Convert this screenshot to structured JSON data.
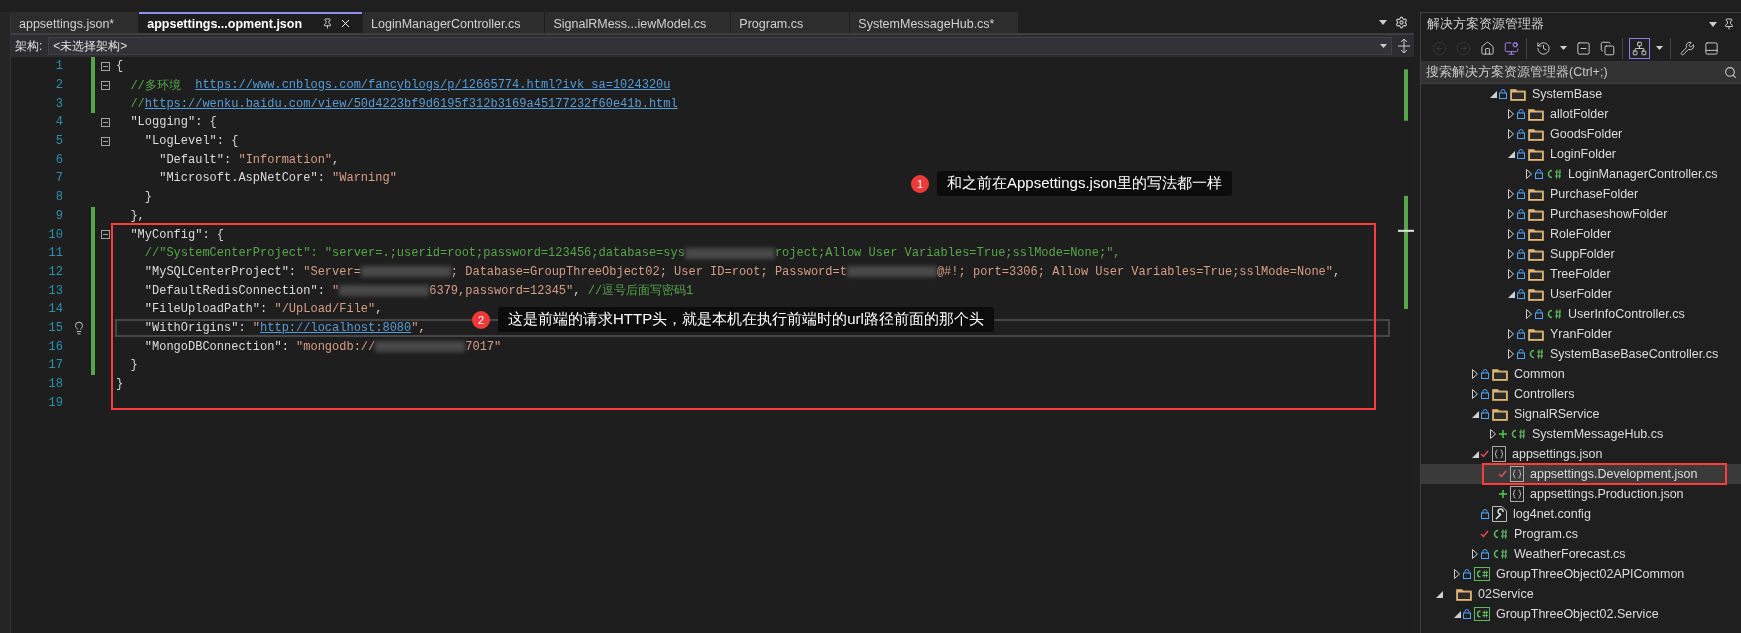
{
  "tabs": [
    {
      "label": "appsettings.json*",
      "selected": false
    },
    {
      "label": "appsettings...opment.json",
      "selected": true
    },
    {
      "label": "LoginManagerController.cs",
      "selected": false
    },
    {
      "label": "SignalRMess...iewModel.cs",
      "selected": false
    },
    {
      "label": "Program.cs",
      "selected": false
    },
    {
      "label": "SystemMessageHub.cs*",
      "selected": false
    }
  ],
  "architecture": {
    "label": "架构:",
    "value": "<未选择架构>"
  },
  "editor": {
    "highlight_box": true,
    "lines": [
      {
        "number": "1",
        "changed": true,
        "fold": true,
        "current": false,
        "tokens": [
          {
            "kind": "punct",
            "text": "{"
          }
        ]
      },
      {
        "number": "2",
        "changed": true,
        "fold": true,
        "current": false,
        "tokens": [
          {
            "kind": "comment",
            "text": "  //多环境  "
          },
          {
            "kind": "link",
            "text": "https://www.cnblogs.com/fancyblogs/p/12665774.html?ivk_sa=1024320u"
          }
        ]
      },
      {
        "number": "3",
        "changed": true,
        "fold": false,
        "current": false,
        "tokens": [
          {
            "kind": "comment",
            "text": "  //"
          },
          {
            "kind": "link",
            "text": "https://wenku.baidu.com/view/50d4223bf9d6195f312b3169a45177232f60e41b.html"
          }
        ]
      },
      {
        "number": "4",
        "changed": false,
        "fold": true,
        "current": false,
        "tokens": [
          {
            "kind": "key",
            "text": "  \"Logging\""
          },
          {
            "kind": "punct",
            "text": ": {"
          }
        ]
      },
      {
        "number": "5",
        "changed": false,
        "fold": true,
        "current": false,
        "tokens": [
          {
            "kind": "key",
            "text": "    \"LogLevel\""
          },
          {
            "kind": "punct",
            "text": ": {"
          }
        ]
      },
      {
        "number": "6",
        "changed": false,
        "fold": false,
        "current": false,
        "tokens": [
          {
            "kind": "key",
            "text": "      \"Default\""
          },
          {
            "kind": "punct",
            "text": ": "
          },
          {
            "kind": "string",
            "text": "\"Information\""
          },
          {
            "kind": "punct",
            "text": ","
          }
        ]
      },
      {
        "number": "7",
        "changed": false,
        "fold": false,
        "current": false,
        "tokens": [
          {
            "kind": "key",
            "text": "      \"Microsoft.AspNetCore\""
          },
          {
            "kind": "punct",
            "text": ": "
          },
          {
            "kind": "string",
            "text": "\"Warning\""
          }
        ]
      },
      {
        "number": "8",
        "changed": false,
        "fold": false,
        "current": false,
        "tokens": [
          {
            "kind": "punct",
            "text": "    }"
          }
        ]
      },
      {
        "number": "9",
        "changed": true,
        "fold": false,
        "current": false,
        "tokens": [
          {
            "kind": "punct",
            "text": "  },"
          }
        ]
      },
      {
        "number": "10",
        "changed": true,
        "fold": true,
        "current": false,
        "tokens": [
          {
            "kind": "key",
            "text": "  \"MyConfig\""
          },
          {
            "kind": "punct",
            "text": ": {"
          }
        ]
      },
      {
        "number": "11",
        "changed": true,
        "fold": false,
        "current": false,
        "tokens": [
          {
            "kind": "comment",
            "text": "    //\"SystemCenterProject\": \"server=.;userid=root;password=123456;database=sys"
          },
          {
            "kind": "redacted"
          },
          {
            "kind": "comment",
            "text": "roject;Allow User Variables=True;sslMode=None;\","
          }
        ]
      },
      {
        "number": "12",
        "changed": true,
        "fold": false,
        "current": false,
        "tokens": [
          {
            "kind": "key",
            "text": "    \"MySQLCenterProject\""
          },
          {
            "kind": "punct",
            "text": ": "
          },
          {
            "kind": "string",
            "text": "\"Server="
          },
          {
            "kind": "redacted"
          },
          {
            "kind": "string",
            "text": "; Database=GroupThreeObject02; User ID=root; Password=t"
          },
          {
            "kind": "redacted"
          },
          {
            "kind": "string",
            "text": "@#!; port=3306; Allow User Variables=True;sslMode=None\""
          },
          {
            "kind": "punct",
            "text": ","
          }
        ]
      },
      {
        "number": "13",
        "changed": true,
        "fold": false,
        "current": false,
        "tokens": [
          {
            "kind": "key",
            "text": "    \"DefaultRedisConnection\""
          },
          {
            "kind": "punct",
            "text": ": "
          },
          {
            "kind": "string",
            "text": "\""
          },
          {
            "kind": "redacted"
          },
          {
            "kind": "string",
            "text": "6379,password=12345\""
          },
          {
            "kind": "punct",
            "text": ", "
          },
          {
            "kind": "comment",
            "text": "//逗号后面写密码1"
          }
        ]
      },
      {
        "number": "14",
        "changed": true,
        "fold": false,
        "current": false,
        "tokens": [
          {
            "kind": "key",
            "text": "    \"FileUploadPath\""
          },
          {
            "kind": "punct",
            "text": ": "
          },
          {
            "kind": "string",
            "text": "\"/UpLoad/File\""
          },
          {
            "kind": "punct",
            "text": ","
          }
        ]
      },
      {
        "number": "15",
        "changed": true,
        "fold": false,
        "current": true,
        "tokens": [
          {
            "kind": "key",
            "text": "    \"WithOrigins\""
          },
          {
            "kind": "punct",
            "text": ": "
          },
          {
            "kind": "string",
            "text": "\""
          },
          {
            "kind": "link",
            "text": "http://localhost:8080"
          },
          {
            "kind": "string",
            "text": "\""
          },
          {
            "kind": "punct",
            "text": ","
          }
        ]
      },
      {
        "number": "16",
        "changed": true,
        "fold": false,
        "current": false,
        "tokens": [
          {
            "kind": "key",
            "text": "    \"MongoDBConnection\""
          },
          {
            "kind": "punct",
            "text": ": "
          },
          {
            "kind": "string",
            "text": "\"mongodb://"
          },
          {
            "kind": "redacted"
          },
          {
            "kind": "string",
            "text": "7017\""
          }
        ]
      },
      {
        "number": "17",
        "changed": true,
        "fold": false,
        "current": false,
        "tokens": [
          {
            "kind": "punct",
            "text": "  }"
          }
        ]
      },
      {
        "number": "18",
        "changed": false,
        "fold": false,
        "current": false,
        "tokens": [
          {
            "kind": "punct",
            "text": "}"
          }
        ]
      },
      {
        "number": "19",
        "changed": false,
        "fold": false,
        "current": false
      }
    ],
    "annotations": [
      {
        "number": "1",
        "text": "和之前在Appsettings.json里的写法都一样"
      },
      {
        "number": "2",
        "text": "这是前端的请求HTTP头，就是本机在执行前端时的url路径前面的那个头"
      }
    ]
  },
  "explorer": {
    "title": "解决方案资源管理器",
    "toolbar": [
      {
        "buttons": [
          {
            "kind": "back",
            "disabled": true,
            "pressed": false
          },
          {
            "kind": "forward",
            "disabled": true,
            "pressed": false
          },
          {
            "kind": "home",
            "disabled": false,
            "pressed": false
          },
          {
            "kind": "switch-views",
            "disabled": false,
            "pressed": false
          }
        ]
      },
      {
        "buttons": [
          {
            "kind": "history",
            "disabled": false,
            "pressed": false
          },
          {
            "kind": "dropdown",
            "disabled": false,
            "pressed": false
          },
          {
            "kind": "collapse",
            "disabled": false,
            "pressed": false
          },
          {
            "kind": "copy",
            "disabled": false,
            "pressed": false
          }
        ]
      },
      {
        "buttons": [
          {
            "kind": "tree-view",
            "disabled": false,
            "pressed": true
          },
          {
            "kind": "dropdown",
            "disabled": false,
            "pressed": false
          }
        ]
      },
      {
        "buttons": [
          {
            "kind": "properties",
            "disabled": false,
            "pressed": false
          },
          {
            "kind": "preview",
            "disabled": false,
            "pressed": false
          }
        ]
      }
    ],
    "search": {
      "placeholder": "搜索解决方案资源管理器(Ctrl+;)"
    },
    "tree": [
      {
        "children": [
          {
            "children": [
              {
                "children": [
                  {
                    "label": "SystemBase",
                    "kind": "folder",
                    "locked": true,
                    "edited": false,
                    "added": false,
                    "expanded": true,
                    "selected": false,
                    "marked": false,
                    "children": [
                      {
                        "label": "allotFolder",
                        "kind": "folder",
                        "locked": true,
                        "edited": false,
                        "added": false,
                        "expanded": false,
                        "selected": false,
                        "marked": false
                      },
                      {
                        "label": "GoodsFolder",
                        "kind": "folder",
                        "locked": true,
                        "edited": false,
                        "added": false,
                        "expanded": false,
                        "selected": false,
                        "marked": false
                      },
                      {
                        "label": "LoginFolder",
                        "kind": "folder",
                        "locked": true,
                        "edited": false,
                        "added": false,
                        "expanded": true,
                        "selected": false,
                        "marked": false,
                        "children": [
                          {
                            "label": "LoginManagerController.cs",
                            "kind": "csharp",
                            "locked": true,
                            "edited": false,
                            "added": false,
                            "expanded": false,
                            "selected": false,
                            "marked": false
                          }
                        ]
                      },
                      {
                        "label": "PurchaseFolder",
                        "kind": "folder",
                        "locked": true,
                        "edited": false,
                        "added": false,
                        "expanded": false,
                        "selected": false,
                        "marked": false
                      },
                      {
                        "label": "PurchaseshowFolder",
                        "kind": "folder",
                        "locked": true,
                        "edited": false,
                        "added": false,
                        "expanded": false,
                        "selected": false,
                        "marked": false
                      },
                      {
                        "label": "RoleFolder",
                        "kind": "folder",
                        "locked": true,
                        "edited": false,
                        "added": false,
                        "expanded": false,
                        "selected": false,
                        "marked": false
                      },
                      {
                        "label": "SuppFolder",
                        "kind": "folder",
                        "locked": true,
                        "edited": false,
                        "added": false,
                        "expanded": false,
                        "selected": false,
                        "marked": false
                      },
                      {
                        "label": "TreeFolder",
                        "kind": "folder",
                        "locked": true,
                        "edited": false,
                        "added": false,
                        "expanded": false,
                        "selected": false,
                        "marked": false
                      },
                      {
                        "label": "UserFolder",
                        "kind": "folder",
                        "locked": true,
                        "edited": false,
                        "added": false,
                        "expanded": true,
                        "selected": false,
                        "marked": false,
                        "children": [
                          {
                            "label": "UserInfoController.cs",
                            "kind": "csharp",
                            "locked": true,
                            "edited": false,
                            "added": false,
                            "expanded": false,
                            "selected": false,
                            "marked": false
                          }
                        ]
                      },
                      {
                        "label": "YranFolder",
                        "kind": "folder",
                        "locked": true,
                        "edited": false,
                        "added": false,
                        "expanded": false,
                        "selected": false,
                        "marked": false
                      },
                      {
                        "label": "SystemBaseBaseController.cs",
                        "kind": "csharp",
                        "locked": true,
                        "edited": false,
                        "added": false,
                        "expanded": false,
                        "selected": false,
                        "marked": false
                      }
                    ]
                  }
                ]
              },
              {
                "label": "Common",
                "kind": "folder",
                "locked": true,
                "edited": false,
                "added": false,
                "expanded": false,
                "selected": false,
                "marked": false
              },
              {
                "label": "Controllers",
                "kind": "folder",
                "locked": true,
                "edited": false,
                "added": false,
                "expanded": false,
                "selected": false,
                "marked": false
              },
              {
                "label": "SignalRService",
                "kind": "folder",
                "locked": true,
                "edited": false,
                "added": false,
                "expanded": true,
                "selected": false,
                "marked": false,
                "children": [
                  {
                    "label": "SystemMessageHub.cs",
                    "kind": "csharp",
                    "locked": false,
                    "edited": false,
                    "added": true,
                    "expanded": false,
                    "selected": false,
                    "marked": false
                  }
                ]
              },
              {
                "label": "appsettings.json",
                "kind": "json",
                "locked": false,
                "edited": true,
                "added": false,
                "expanded": true,
                "selected": false,
                "marked": false,
                "children": [
                  {
                    "label": "appsettings.Development.json",
                    "kind": "json",
                    "locked": false,
                    "edited": true,
                    "added": false,
                    "selected": true,
                    "marked": true
                  },
                  {
                    "label": "appsettings.Production.json",
                    "kind": "json",
                    "locked": false,
                    "edited": false,
                    "added": true,
                    "selected": false,
                    "marked": false
                  }
                ]
              },
              {
                "label": "log4net.config",
                "kind": "config",
                "locked": true,
                "edited": false,
                "added": false,
                "selected": false,
                "marked": false
              },
              {
                "label": "Program.cs",
                "kind": "csharp",
                "locked": false,
                "edited": true,
                "added": false,
                "selected": false,
                "marked": false
              },
              {
                "label": "WeatherForecast.cs",
                "kind": "csharp",
                "locked": true,
                "edited": false,
                "added": false,
                "expanded": false,
                "selected": false,
                "marked": false
              }
            ]
          },
          {
            "label": "GroupThreeObject02APICommon",
            "kind": "project",
            "locked": true,
            "edited": false,
            "added": false,
            "expanded": false,
            "selected": false,
            "marked": false
          }
        ]
      },
      {
        "label": "02Service",
        "kind": "folder",
        "locked": false,
        "edited": false,
        "added": false,
        "expanded": true,
        "selected": false,
        "marked": false,
        "children": [
          {
            "label": "GroupThreeObject02.Service",
            "kind": "project",
            "locked": true,
            "edited": false,
            "added": false,
            "expanded": true,
            "selected": false,
            "marked": false
          }
        ]
      }
    ]
  }
}
